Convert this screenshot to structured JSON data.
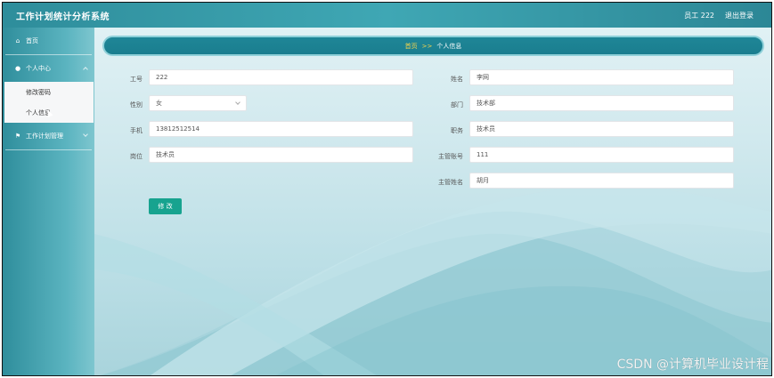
{
  "header": {
    "app_title": "工作计划统计分析系统",
    "user": "员工 222",
    "logout": "退出登录"
  },
  "sidebar": {
    "items": [
      {
        "label": "首页",
        "icon": "home-icon"
      },
      {
        "label": "个人中心",
        "icon": "user-icon",
        "expanded": true,
        "children": [
          {
            "label": "修改密码"
          },
          {
            "label": "个人信息"
          }
        ]
      },
      {
        "label": "工作计划管理",
        "icon": "flag-icon"
      }
    ]
  },
  "breadcrumb": {
    "home": "首页",
    "separator": ">>",
    "current": "个人信息"
  },
  "form": {
    "employee_id": {
      "label": "工号",
      "value": "222"
    },
    "name": {
      "label": "姓名",
      "value": "李网"
    },
    "gender": {
      "label": "性别",
      "value": "女"
    },
    "department": {
      "label": "部门",
      "value": "技术部"
    },
    "phone": {
      "label": "手机",
      "value": "13812512514"
    },
    "title": {
      "label": "职务",
      "value": "技术员"
    },
    "position": {
      "label": "岗位",
      "value": "技术员"
    },
    "manager_account": {
      "label": "主管账号",
      "value": "111"
    },
    "manager_name": {
      "label": "主管姓名",
      "value": "胡月"
    },
    "submit_label": "修 改"
  },
  "watermark": "CSDN @计算机毕业设计程",
  "colors": {
    "header": "#3fa7b4",
    "breadcrumb_bg": "#1f8697",
    "breadcrumb_text": "#f6d54b",
    "button": "#17a38f"
  }
}
